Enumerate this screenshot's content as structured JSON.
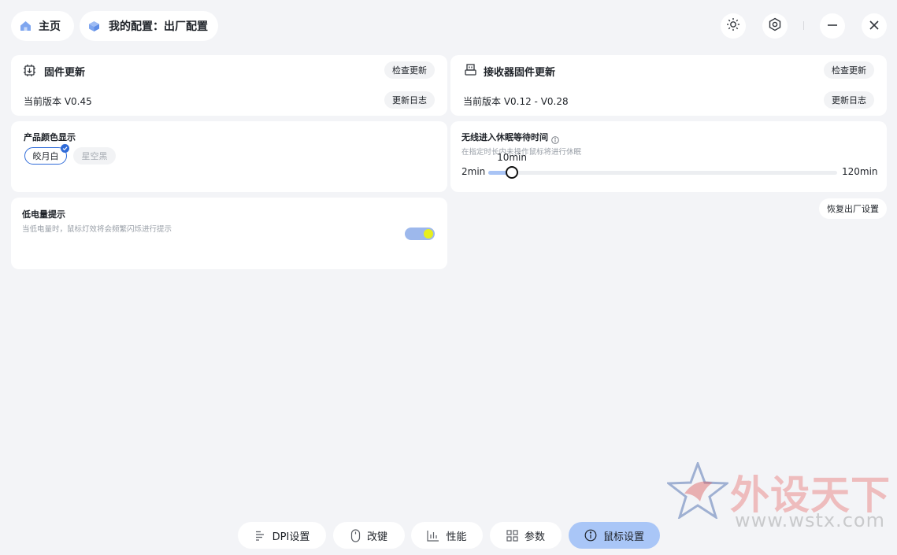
{
  "header": {
    "home_label": "主页",
    "config_label": "我的配置：出厂配置",
    "icons": [
      "brightness-icon",
      "hexagon-settings-icon",
      "minimize-icon",
      "close-icon"
    ]
  },
  "firmware": {
    "title": "固件更新",
    "check_label": "检查更新",
    "version_text": "当前版本 V0.45",
    "changelog_label": "更新日志"
  },
  "receiver": {
    "title": "接收器固件更新",
    "check_label": "检查更新",
    "version_text": "当前版本 V0.12 - V0.28",
    "changelog_label": "更新日志"
  },
  "color": {
    "title": "产品颜色显示",
    "options": [
      "皎月白",
      "星空黑"
    ],
    "selected": "皎月白",
    "accent": "#2f6bd8"
  },
  "sleep": {
    "title": "无线进入休眠等待时间",
    "subtitle": "在指定时长内未操作鼠标将进行休眠",
    "min_label": "2min",
    "max_label": "120min",
    "value_label": "10min",
    "min": 2,
    "max": 120,
    "value": 10
  },
  "battery": {
    "title": "低电量提示",
    "subtitle": "当低电量时，鼠标灯效将会频繁闪烁进行提示",
    "enabled": true
  },
  "reset_label": "恢复出厂设置",
  "nav": {
    "tabs": [
      {
        "label": "DPI设置",
        "icon": "dpi-icon"
      },
      {
        "label": "改键",
        "icon": "mouse-icon"
      },
      {
        "label": "性能",
        "icon": "performance-icon"
      },
      {
        "label": "参数",
        "icon": "grid-icon"
      },
      {
        "label": "鼠标设置",
        "icon": "info-icon"
      }
    ],
    "active": "鼠标设置"
  },
  "watermark": {
    "brand": "外设天下",
    "url": "www.wstx.com"
  }
}
